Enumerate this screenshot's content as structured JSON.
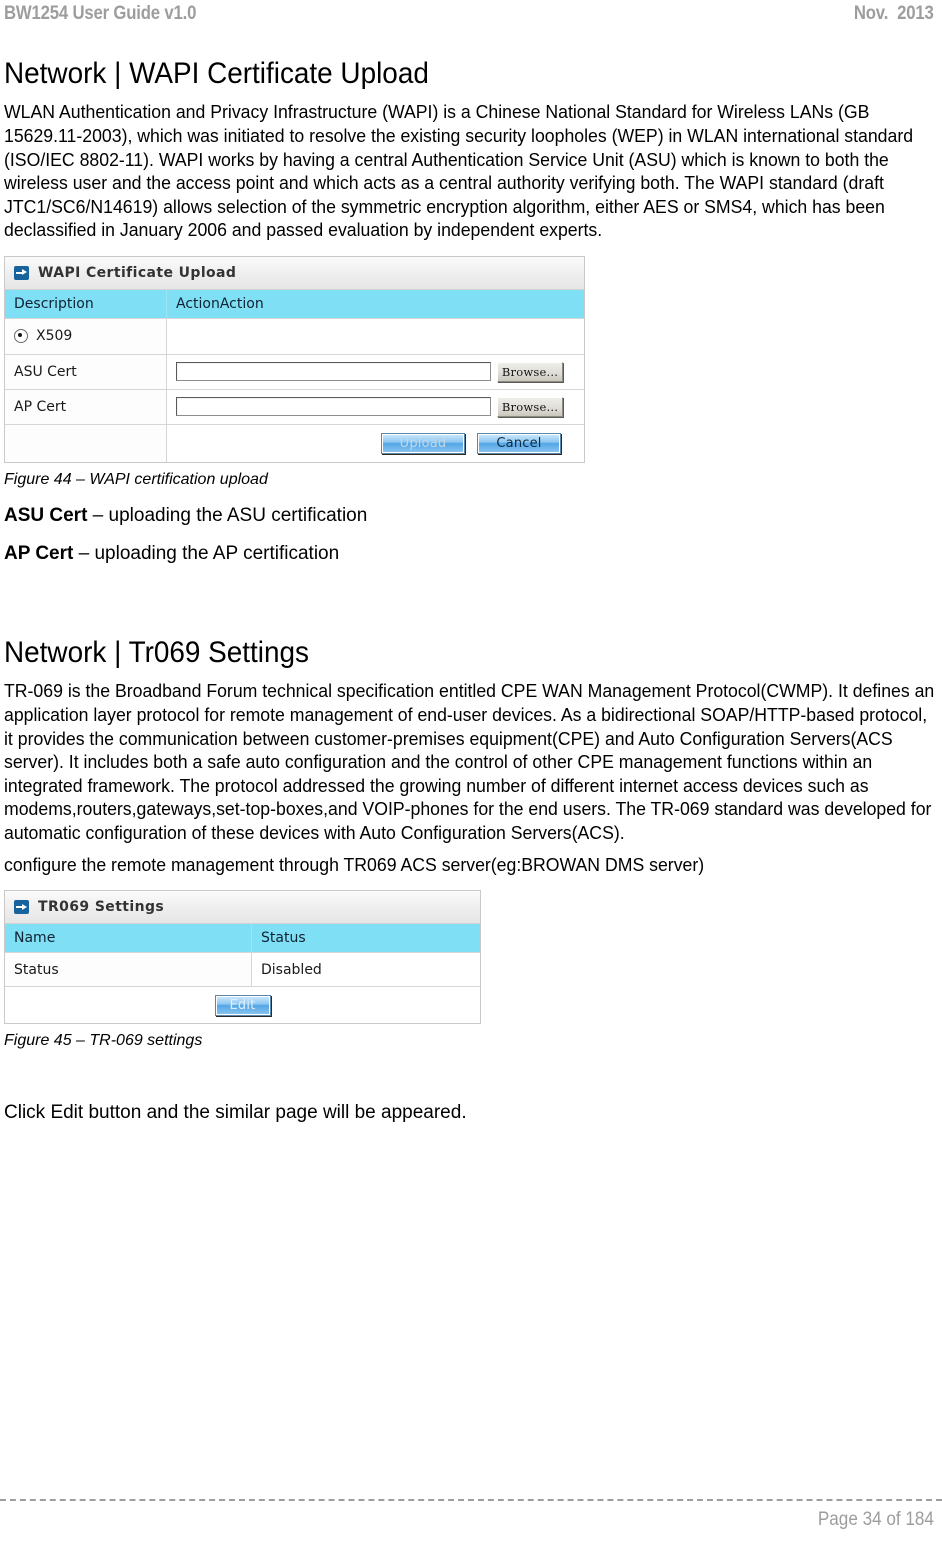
{
  "header": {
    "doc_title": "BW1254 User Guide v1.0",
    "date": "Nov.  2013"
  },
  "footer": {
    "page_label": "Page 34 of 184"
  },
  "sections": [
    {
      "title": "Network | WAPI Certificate Upload",
      "paragraphs": [
        "WLAN Authentication and Privacy Infrastructure (WAPI) is a Chinese National Standard for Wireless LANs (GB 15629.11-2003), which was initiated to resolve the existing security loopholes (WEP) in WLAN international standard (ISO/IEC 8802-11). WAPI works by having a central Authentication Service Unit (ASU) which is known to both the wireless user and the access point and which acts as a central authority verifying both. The WAPI standard (draft JTC1/SC6/N14619) allows selection of the symmetric encryption algorithm, either AES or SMS4, which has been declassified in January 2006 and passed evaluation by independent experts."
      ],
      "caption": "Figure 44 – WAPI certification upload",
      "definitions": [
        {
          "term": "ASU Cert",
          "text": " – uploading the ASU certification"
        },
        {
          "term": "AP Cert",
          "text": " –  uploading the AP certification"
        }
      ]
    },
    {
      "title": "Network | Tr069 Settings",
      "paragraphs": [
        "TR-069 is the Broadband Forum technical specification entitled CPE WAN Management Protocol(CWMP). It defines an application layer protocol for remote management of end-user devices. As a bidirectional SOAP/HTTP-based protocol, it provides the communication between customer-premises equipment(CPE) and Auto Configuration Servers(ACS server). It includes both a safe auto configuration and the control of other CPE management functions within an integrated framework. The protocol addressed the growing number of different internet access devices such as modems,routers,gateways,set-top-boxes,and VOIP-phones for the end users. The TR-069 standard was developed for automatic configuration of these devices with Auto Configuration Servers(ACS).",
        "configure the remote management through TR069 ACS server(eg:BROWAN DMS server)"
      ],
      "caption": "Figure 45 – TR-069 settings",
      "closing": "Click Edit button and the similar page will be appeared."
    }
  ],
  "wapi_panel": {
    "panel_title": "WAPI Certificate Upload",
    "icon": "arrow-right-icon",
    "columns": [
      "Description",
      "ActionAction"
    ],
    "radio_row": {
      "label": "X509",
      "checked": true
    },
    "fields": [
      {
        "label": "ASU Cert",
        "value": "",
        "button": "Browse..."
      },
      {
        "label": "AP Cert",
        "value": "",
        "button": "Browse..."
      }
    ],
    "buttons": {
      "primary": "Upload",
      "secondary": "Cancel"
    }
  },
  "tr069_panel": {
    "panel_title": "TR069 Settings",
    "icon": "arrow-right-icon",
    "columns": [
      "Name",
      "Status"
    ],
    "rows": [
      {
        "name": "Status",
        "status": "Disabled"
      }
    ],
    "buttons": {
      "edit": "Edit"
    }
  },
  "colors": {
    "table_header_cyan": "#7fdff5",
    "panel_icon_blue": "#16639e",
    "header_gray": "#9d9d9d"
  }
}
